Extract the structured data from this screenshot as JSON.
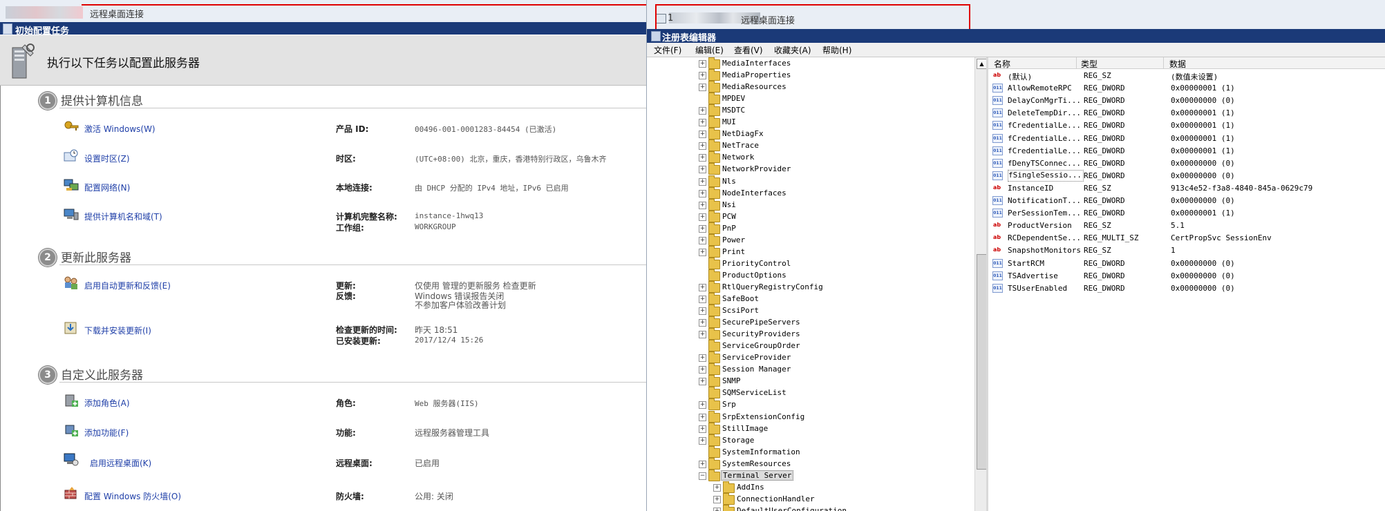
{
  "left_window": {
    "title": "远程桌面连接",
    "app_title": "初始配置任务",
    "header": "执行以下任务以配置此服务器",
    "sections": [
      {
        "number": "1",
        "title": "提供计算机信息",
        "tasks": [
          {
            "label": "激活 Windows(W)",
            "icon": "key-icon"
          },
          {
            "label": "设置时区(Z)",
            "icon": "clock-icon"
          },
          {
            "label": "配置网络(N)",
            "icon": "network-icon"
          },
          {
            "label": "提供计算机名和域(T)",
            "icon": "computer-icon"
          }
        ],
        "properties": [
          {
            "label": "产品 ID:",
            "value": "00496-001-0001283-84454 (已激活)"
          },
          {
            "label": "时区:",
            "value": "(UTC+08:00) 北京，重庆，香港特别行政区，乌鲁木齐"
          },
          {
            "label": "本地连接:",
            "value": "由 DHCP 分配的 IPv4 地址，IPv6 已启用"
          },
          {
            "label": "计算机完整名称:",
            "value": "instance-1hwq13"
          },
          {
            "label": "工作组:",
            "value": "WORKGROUP"
          }
        ]
      },
      {
        "number": "2",
        "title": "更新此服务器",
        "tasks": [
          {
            "label": "启用自动更新和反馈(E)",
            "icon": "users-update-icon"
          },
          {
            "label": "下载并安装更新(I)",
            "icon": "download-update-icon"
          }
        ],
        "properties": [
          {
            "label": "更新:",
            "value": "仅使用 管理的更新服务 检查更新"
          },
          {
            "label": "反馈:",
            "value": "Windows 错误报告关闭"
          },
          {
            "label": "",
            "value": "不参加客户体验改善计划"
          },
          {
            "label": "检查更新的时间:",
            "value": "昨天 18:51"
          },
          {
            "label": "已安装更新:",
            "value": "2017/12/4 15:26"
          }
        ]
      },
      {
        "number": "3",
        "title": "自定义此服务器",
        "tasks": [
          {
            "label": "添加角色(A)",
            "icon": "add-role-icon"
          },
          {
            "label": "添加功能(F)",
            "icon": "add-feature-icon"
          },
          {
            "label": "启用远程桌面(K)",
            "icon": "remote-desktop-icon"
          },
          {
            "label": "配置 Windows 防火墙(O)",
            "icon": "firewall-icon"
          }
        ],
        "properties": [
          {
            "label": "角色:",
            "value": "Web 服务器(IIS)"
          },
          {
            "label": "功能:",
            "value": "远程服务器管理工具"
          },
          {
            "label": "远程桌面:",
            "value": "已启用"
          },
          {
            "label": "防火墙:",
            "value": "公用: 关闭"
          }
        ]
      }
    ]
  },
  "right_window": {
    "title_suffix": "远程桌面连接",
    "title_prefix": "1",
    "app_title": "注册表编辑器",
    "menu": [
      "文件(F)",
      "编辑(E)",
      "查看(V)",
      "收藏夹(A)",
      "帮助(H)"
    ],
    "tree": [
      {
        "label": "MediaInterfaces",
        "expandable": true
      },
      {
        "label": "MediaProperties",
        "expandable": true
      },
      {
        "label": "MediaResources",
        "expandable": true
      },
      {
        "label": "MPDEV",
        "expandable": false
      },
      {
        "label": "MSDTC",
        "expandable": true
      },
      {
        "label": "MUI",
        "expandable": true
      },
      {
        "label": "NetDiagFx",
        "expandable": true
      },
      {
        "label": "NetTrace",
        "expandable": true
      },
      {
        "label": "Network",
        "expandable": true
      },
      {
        "label": "NetworkProvider",
        "expandable": true
      },
      {
        "label": "Nls",
        "expandable": true
      },
      {
        "label": "NodeInterfaces",
        "expandable": true
      },
      {
        "label": "Nsi",
        "expandable": true
      },
      {
        "label": "PCW",
        "expandable": true
      },
      {
        "label": "PnP",
        "expandable": true
      },
      {
        "label": "Power",
        "expandable": true
      },
      {
        "label": "Print",
        "expandable": true
      },
      {
        "label": "PriorityControl",
        "expandable": false
      },
      {
        "label": "ProductOptions",
        "expandable": false
      },
      {
        "label": "RtlQueryRegistryConfig",
        "expandable": true
      },
      {
        "label": "SafeBoot",
        "expandable": true
      },
      {
        "label": "ScsiPort",
        "expandable": true
      },
      {
        "label": "SecurePipeServers",
        "expandable": true
      },
      {
        "label": "SecurityProviders",
        "expandable": true
      },
      {
        "label": "ServiceGroupOrder",
        "expandable": false
      },
      {
        "label": "ServiceProvider",
        "expandable": true
      },
      {
        "label": "Session Manager",
        "expandable": true
      },
      {
        "label": "SNMP",
        "expandable": true
      },
      {
        "label": "SQMServiceList",
        "expandable": false
      },
      {
        "label": "Srp",
        "expandable": true
      },
      {
        "label": "SrpExtensionConfig",
        "expandable": true
      },
      {
        "label": "StillImage",
        "expandable": true
      },
      {
        "label": "Storage",
        "expandable": true
      },
      {
        "label": "SystemInformation",
        "expandable": false
      },
      {
        "label": "SystemResources",
        "expandable": true
      },
      {
        "label": "Terminal Server",
        "expandable": true,
        "expanded": true,
        "selected": true
      },
      {
        "label": "AddIns",
        "expandable": true,
        "child": true
      },
      {
        "label": "ConnectionHandler",
        "expandable": true,
        "child": true
      },
      {
        "label": "DefaultUserConfiguration",
        "expandable": true,
        "child": true
      }
    ],
    "columns": [
      "名称",
      "类型",
      "数据"
    ],
    "values": [
      {
        "icon": "string",
        "name": "(默认)",
        "type": "REG_SZ",
        "data": "(数值未设置)"
      },
      {
        "icon": "binary",
        "name": "AllowRemoteRPC",
        "type": "REG_DWORD",
        "data": "0x00000001 (1)"
      },
      {
        "icon": "binary",
        "name": "DelayConMgrTi...",
        "type": "REG_DWORD",
        "data": "0x00000000 (0)"
      },
      {
        "icon": "binary",
        "name": "DeleteTempDir...",
        "type": "REG_DWORD",
        "data": "0x00000001 (1)"
      },
      {
        "icon": "binary",
        "name": "fCredentialLe...",
        "type": "REG_DWORD",
        "data": "0x00000001 (1)"
      },
      {
        "icon": "binary",
        "name": "fCredentialLe...",
        "type": "REG_DWORD",
        "data": "0x00000001 (1)"
      },
      {
        "icon": "binary",
        "name": "fCredentialLe...",
        "type": "REG_DWORD",
        "data": "0x00000001 (1)"
      },
      {
        "icon": "binary",
        "name": "fDenyTSConnec...",
        "type": "REG_DWORD",
        "data": "0x00000000 (0)"
      },
      {
        "icon": "binary",
        "name": "fSingleSessio...",
        "type": "REG_DWORD",
        "data": "0x00000000 (0)",
        "focused": true
      },
      {
        "icon": "string",
        "name": "InstanceID",
        "type": "REG_SZ",
        "data": "913c4e52-f3a8-4840-845a-0629c79"
      },
      {
        "icon": "binary",
        "name": "NotificationT...",
        "type": "REG_DWORD",
        "data": "0x00000000 (0)"
      },
      {
        "icon": "binary",
        "name": "PerSessionTem...",
        "type": "REG_DWORD",
        "data": "0x00000001 (1)"
      },
      {
        "icon": "string",
        "name": "ProductVersion",
        "type": "REG_SZ",
        "data": "5.1"
      },
      {
        "icon": "string",
        "name": "RCDependentSe...",
        "type": "REG_MULTI_SZ",
        "data": "CertPropSvc SessionEnv"
      },
      {
        "icon": "string",
        "name": "SnapshotMonitors",
        "type": "REG_SZ",
        "data": "1"
      },
      {
        "icon": "binary",
        "name": "StartRCM",
        "type": "REG_DWORD",
        "data": "0x00000000 (0)"
      },
      {
        "icon": "binary",
        "name": "TSAdvertise",
        "type": "REG_DWORD",
        "data": "0x00000000 (0)"
      },
      {
        "icon": "binary",
        "name": "TSUserEnabled",
        "type": "REG_DWORD",
        "data": "0x00000000 (0)"
      }
    ]
  },
  "colors": {
    "app_bar": "#1b3a78",
    "link": "#1f3fa8",
    "highlight_box": "#e00000"
  }
}
